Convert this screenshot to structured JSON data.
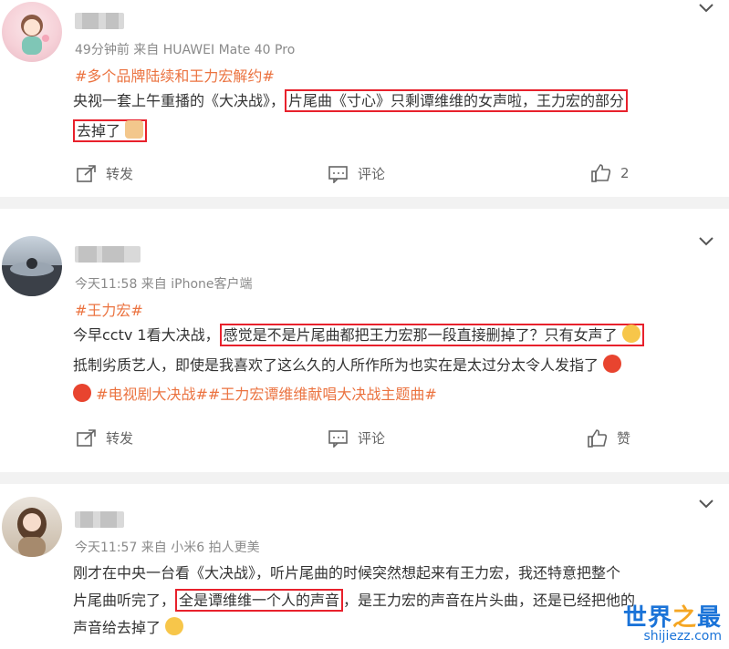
{
  "posts": [
    {
      "meta": "49分钟前  来自 HUAWEI Mate 40 Pro",
      "tag": "#多个品牌陆续和王力宏解约#",
      "line1_a": "央视一套上午重播的《大决战》，",
      "line1_hl": "片尾曲《寸心》只剩谭维维的女声啦，王力宏的部分",
      "line2_hl": "去掉了",
      "repost": "转发",
      "comment": "评论",
      "like": "2"
    },
    {
      "meta": "今天11:58  来自 iPhone客户端",
      "tag": "#王力宏#",
      "line1_a": "今早cctv 1看大决战，",
      "line1_hl": "感觉是不是片尾曲都把王力宏那一段直接删掉了？只有女声了",
      "line2": "抵制劣质艺人，即使是我喜欢了这么久的人所作所为也实在是太过分太令人发指了",
      "line3_tags": "#电视剧大决战##王力宏谭维维献唱大决战主题曲#",
      "repost": "转发",
      "comment": "评论",
      "like": "赞"
    },
    {
      "meta": "今天11:57  来自 小米6 拍人更美",
      "line1": "刚才在中央一台看《大决战》，听片尾曲的时候突然想起来有王力宏，我还特意把整个",
      "line2_a": "片尾曲听完了，",
      "line2_hl": "全是谭维维一个人的声音",
      "line2_b": "，是王力宏的声音在片头曲，还是已经把他的",
      "line3": "声音给去掉了"
    }
  ],
  "watermark": {
    "title_a": "世界",
    "title_b": "之",
    "title_c": "最",
    "url": "shijiezz.com"
  },
  "colors": {
    "topic": "#eb7340",
    "highlight_border": "#e8212c",
    "watermark": "#1a73d8"
  }
}
